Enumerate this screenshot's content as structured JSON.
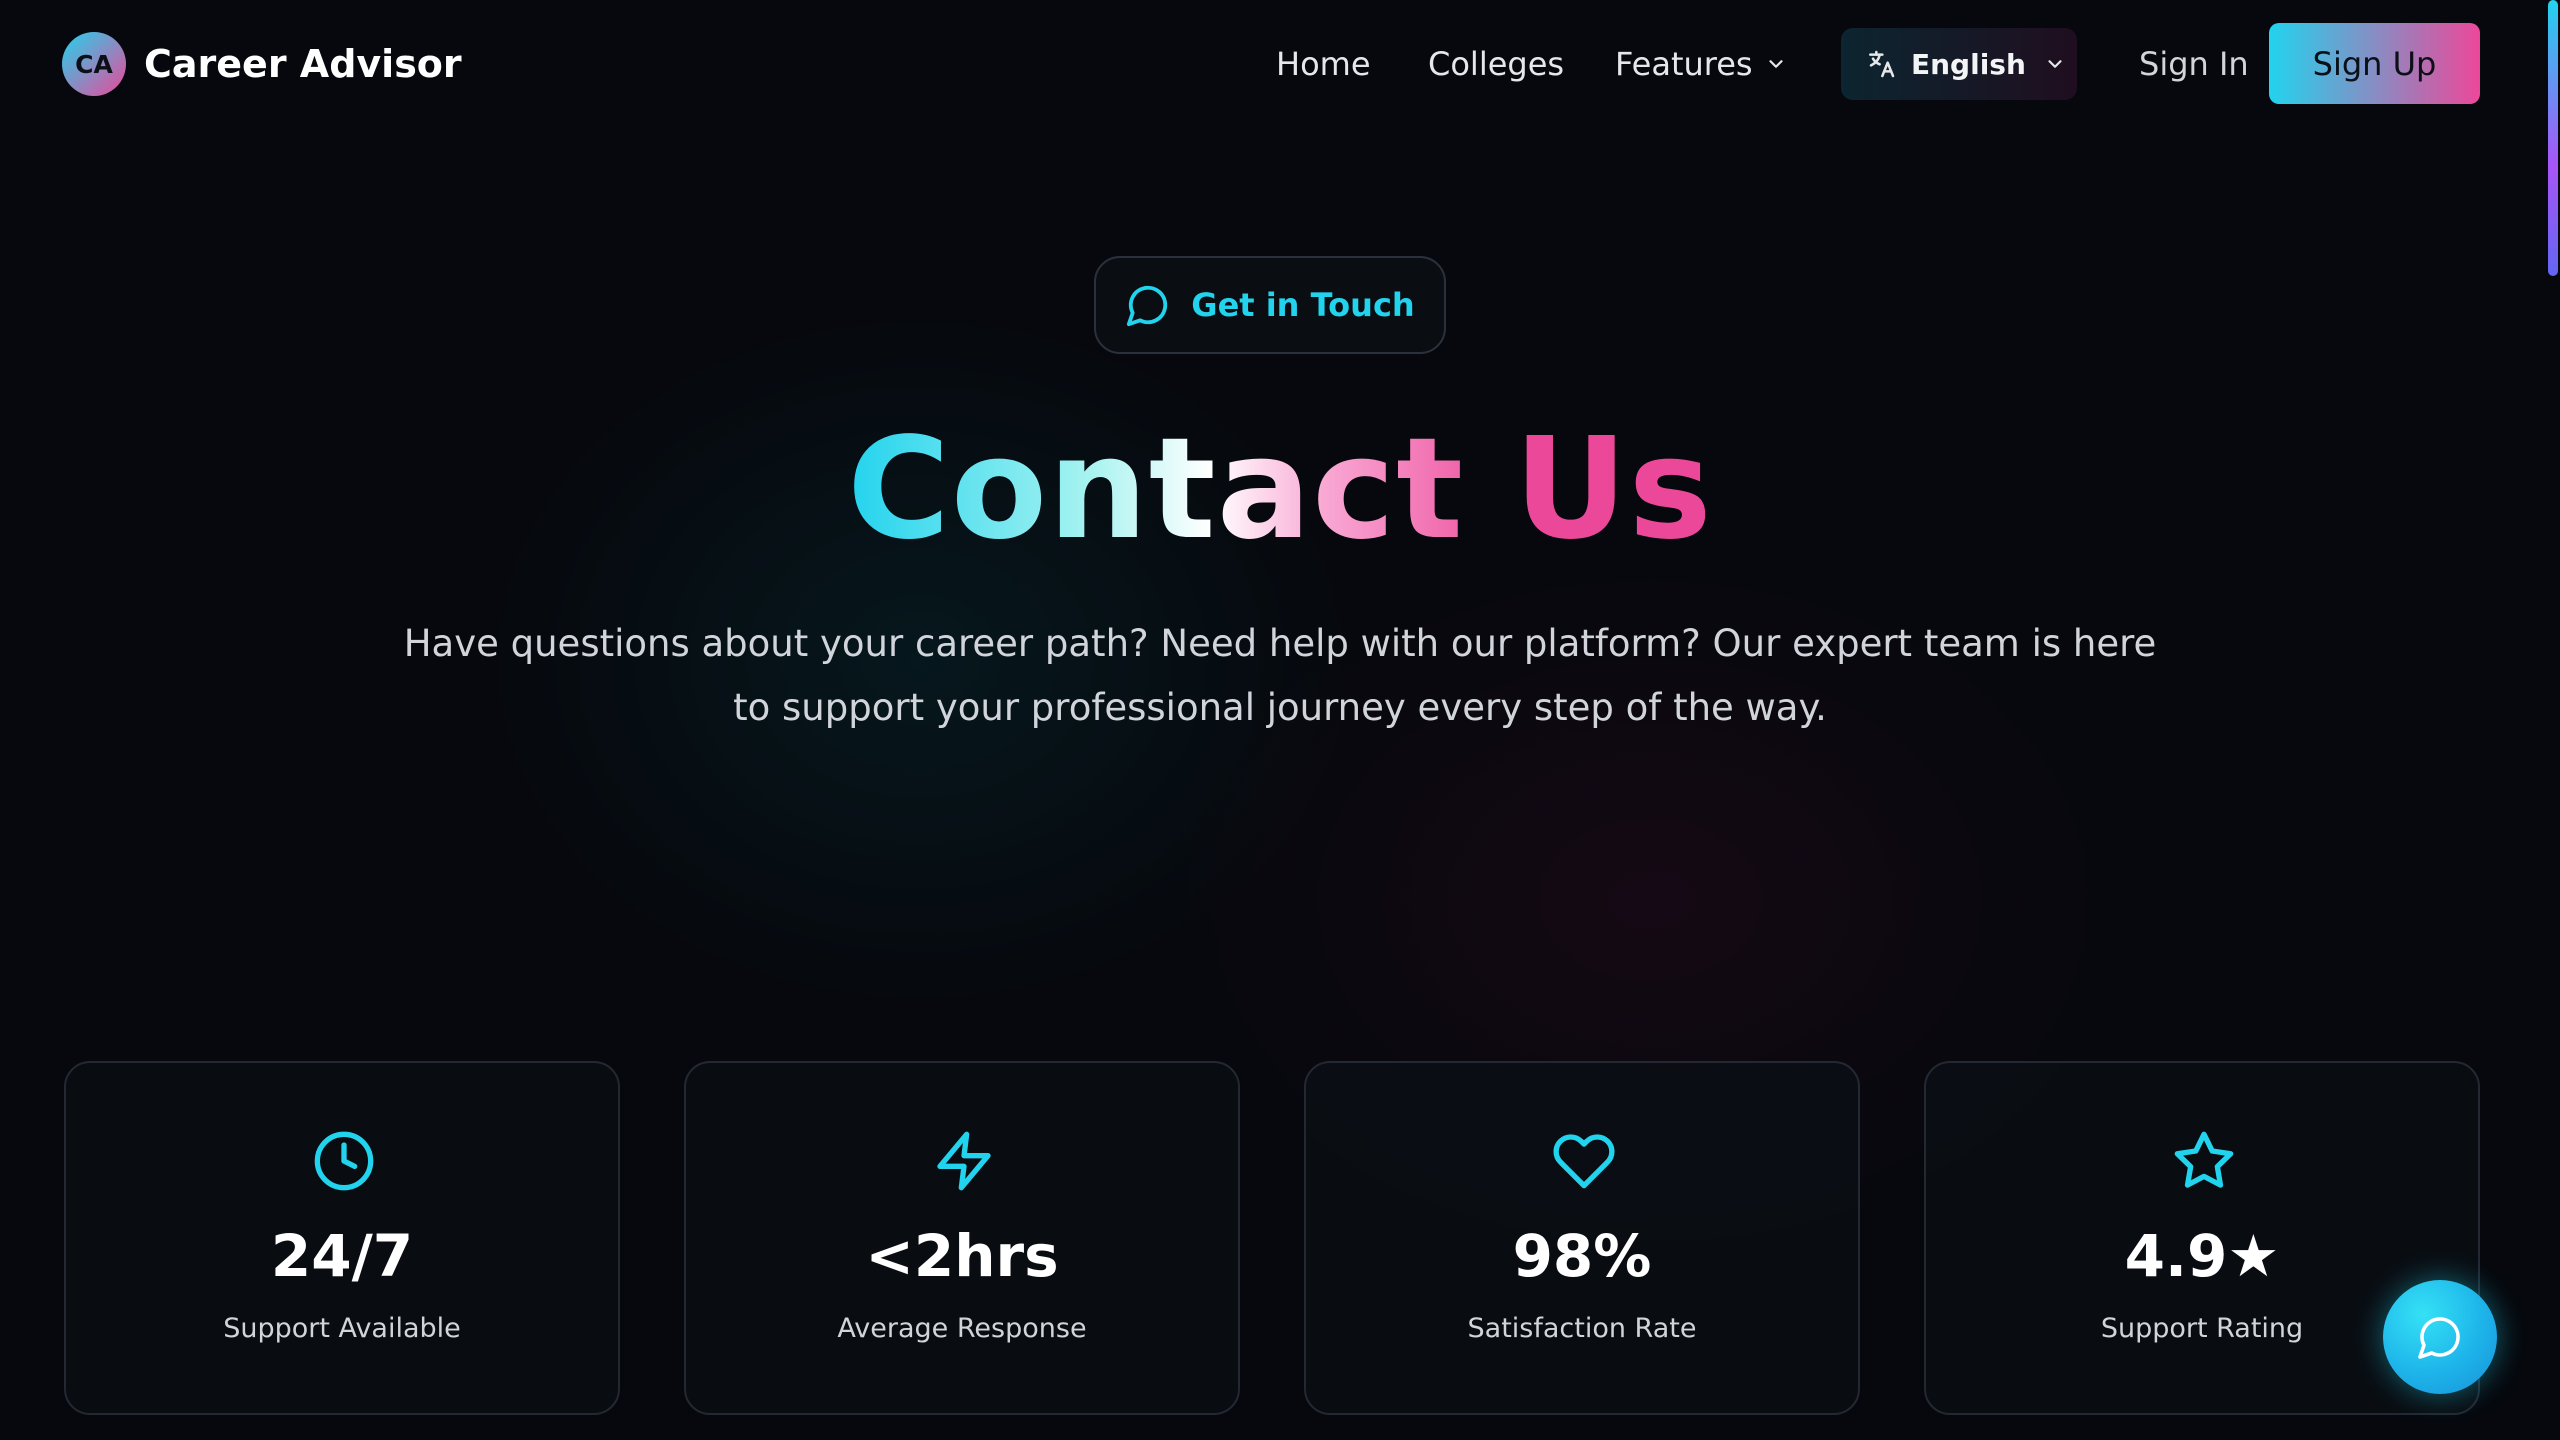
{
  "brand": {
    "badge": "CA",
    "name": "Career Advisor"
  },
  "nav": {
    "items": [
      "Home",
      "Colleges",
      "Features"
    ],
    "language": "English",
    "sign_in": "Sign In",
    "sign_up": "Sign Up"
  },
  "hero": {
    "badge": "Get in Touch",
    "title": "Contact Us",
    "subtitle": "Have questions about your career path? Need help with our platform? Our expert team is here to support your professional journey every step of the way."
  },
  "stats": [
    {
      "value": "24/7",
      "label": "Support Available",
      "icon": "clock-icon"
    },
    {
      "value": "<2hrs",
      "label": "Average Response",
      "icon": "lightning-icon"
    },
    {
      "value": "98%",
      "label": "Satisfaction Rate",
      "icon": "heart-icon"
    },
    {
      "value": "4.9★",
      "label": "Support Rating",
      "icon": "star-icon"
    }
  ],
  "colors": {
    "accent_cyan": "#22d3ee",
    "accent_pink": "#ec4899",
    "background": "#06080d"
  }
}
